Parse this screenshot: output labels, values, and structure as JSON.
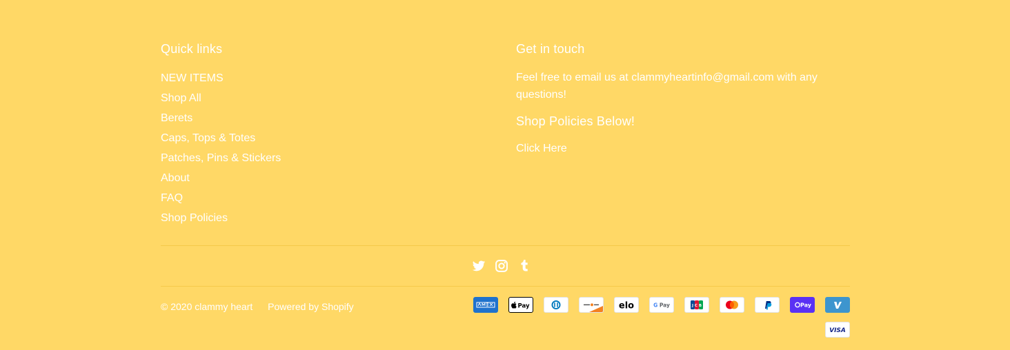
{
  "quick_links": {
    "title": "Quick links",
    "items": [
      {
        "label": "NEW ITEMS"
      },
      {
        "label": "Shop All"
      },
      {
        "label": "Berets"
      },
      {
        "label": "Caps, Tops & Totes"
      },
      {
        "label": "Patches, Pins & Stickers"
      },
      {
        "label": "About"
      },
      {
        "label": "FAQ"
      },
      {
        "label": "Shop Policies"
      }
    ]
  },
  "contact": {
    "title": "Get in touch",
    "text": "Feel free to email us at clammyheartinfo@gmail.com with any questions!",
    "policies_title": "Shop Policies Below!",
    "policies_link": "Click Here"
  },
  "social": [
    "twitter-icon",
    "instagram-icon",
    "tumblr-icon"
  ],
  "footer": {
    "copyright": "© 2020 clammy heart",
    "powered_by": "Powered by Shopify"
  },
  "payment_methods": [
    "American Express",
    "Apple Pay",
    "Diners Club",
    "Discover",
    "Elo",
    "Google Pay",
    "JCB",
    "Mastercard",
    "PayPal",
    "Shop Pay",
    "Venmo",
    "Visa"
  ],
  "colors": {
    "background": "#FFD866",
    "text": "#FFFFFF"
  }
}
